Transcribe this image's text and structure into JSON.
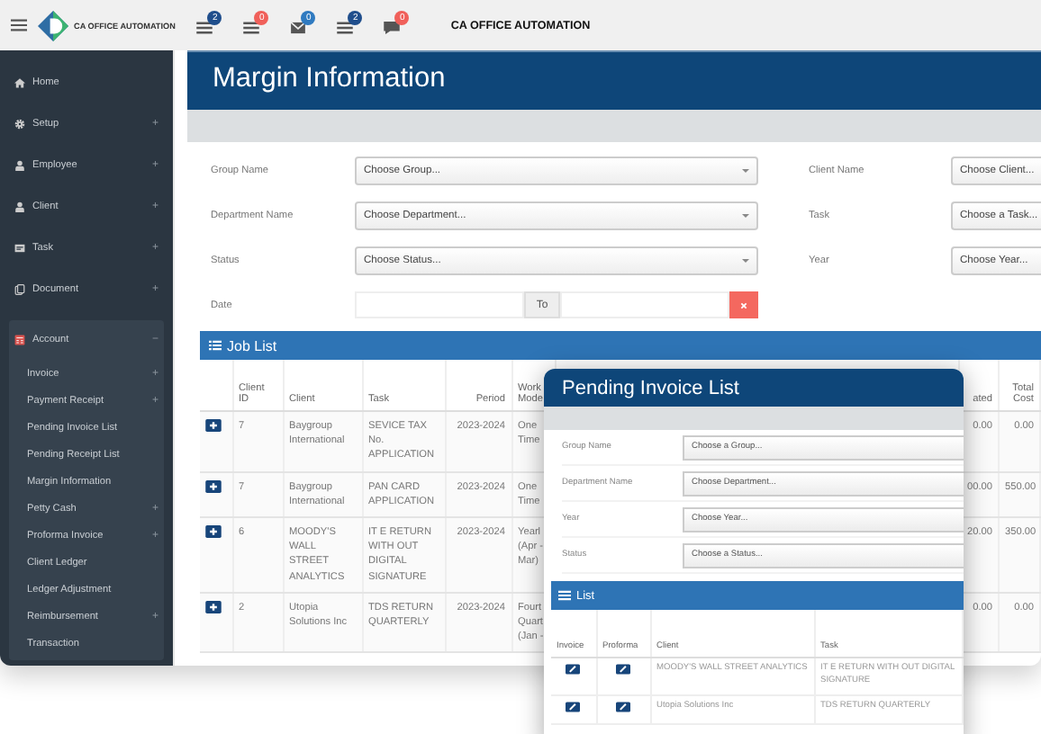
{
  "topbar": {
    "app_name": "CA OFFICE AUTOMATION",
    "title": "CA OFFICE AUTOMATION",
    "notifications": [
      {
        "kind": "list",
        "count": "2",
        "color": "#1f4e8c"
      },
      {
        "kind": "list",
        "count": "0",
        "color": "#f0605a"
      },
      {
        "kind": "envelope",
        "count": "0",
        "color": "#2f7ac0"
      },
      {
        "kind": "list",
        "count": "2",
        "color": "#1f4e8c"
      },
      {
        "kind": "comment",
        "count": "0",
        "color": "#f0605a"
      }
    ]
  },
  "sidebar": {
    "items": [
      {
        "kind": "home",
        "label": "Home",
        "expanded": false
      },
      {
        "kind": "gear",
        "label": "Setup",
        "toggle": "+",
        "expanded": false
      },
      {
        "kind": "user",
        "label": "Employee",
        "toggle": "+",
        "expanded": false
      },
      {
        "kind": "user",
        "label": "Client",
        "toggle": "+",
        "expanded": false
      },
      {
        "kind": "card",
        "label": "Task",
        "toggle": "+",
        "expanded": false
      },
      {
        "kind": "document",
        "label": "Document",
        "toggle": "+",
        "expanded": false
      },
      {
        "kind": "calculator",
        "label": "Account",
        "toggle": "−",
        "expanded": true,
        "children": [
          {
            "label": "Invoice",
            "toggle": "+"
          },
          {
            "label": "Payment Receipt",
            "toggle": "+"
          },
          {
            "label": "Pending Invoice List"
          },
          {
            "label": "Pending Receipt List"
          },
          {
            "label": "Margin Information"
          },
          {
            "label": "Petty Cash",
            "toggle": "+"
          },
          {
            "label": "Proforma Invoice",
            "toggle": "+"
          },
          {
            "label": "Client Ledger"
          },
          {
            "label": "Ledger Adjustment"
          },
          {
            "label": "Reimbursement",
            "toggle": "+"
          },
          {
            "label": "Transaction"
          }
        ]
      }
    ]
  },
  "main": {
    "title": "Margin Information",
    "filters": [
      {
        "kind": "select",
        "label": "Group Name",
        "placeholder": "Choose Group..."
      },
      {
        "kind": "select",
        "label": "Client Name",
        "placeholder": "Choose Client..."
      },
      {
        "kind": "select",
        "label": "Department Name",
        "placeholder": "Choose Department..."
      },
      {
        "kind": "select",
        "label": "Task",
        "placeholder": "Choose a Task..."
      },
      {
        "kind": "select",
        "label": "Status",
        "placeholder": "Choose Status..."
      },
      {
        "kind": "select",
        "label": "Year",
        "placeholder": "Choose Year..."
      },
      {
        "kind": "date_range",
        "label": "Date",
        "separator": "To"
      }
    ],
    "job_list": {
      "title": "Job List",
      "columns": [
        "Client ID",
        "Client",
        "Task",
        "Period",
        "Work Mode",
        "ated",
        "Total Cost"
      ],
      "rows": [
        [
          "7",
          "Baygroup International",
          "SEVICE TAX No. APPLICATION",
          "2023-2024",
          "One Time",
          "0.00",
          "0.00"
        ],
        [
          "7",
          "Baygroup International",
          "PAN CARD APPLICATION",
          "2023-2024",
          "One Time",
          "00.00",
          "550.00"
        ],
        [
          "6",
          "MOODY'S WALL STREET ANALYTICS",
          "IT E RETURN WITH OUT DIGITAL SIGNATURE",
          "2023-2024",
          "Yearl (Apr - Mar)",
          "20.00",
          "350.00"
        ],
        [
          "2",
          "Utopia Solutions Inc",
          "TDS RETURN QUARTERLY",
          "2023-2024",
          "Fourt Quart (Jan -",
          "0.00",
          "0.00"
        ]
      ]
    }
  },
  "pending_invoice_panel": {
    "title": "Pending Invoice List",
    "filters": [
      {
        "label": "Group Name",
        "placeholder": "Choose a Group..."
      },
      {
        "label": "Department Name",
        "placeholder": "Choose Department..."
      },
      {
        "label": "Year",
        "placeholder": "Choose Year..."
      },
      {
        "label": "Status",
        "placeholder": "Choose a Status..."
      }
    ],
    "list": {
      "title": "List",
      "columns": [
        "Invoice",
        "Proforma",
        "Client",
        "Task"
      ],
      "rows": [
        {
          "client": "MOODY'S WALL STREET ANALYTICS",
          "task": "IT E RETURN WITH OUT DIGITAL SIGNATURE"
        },
        {
          "client": "Utopia Solutions Inc",
          "task": "TDS RETURN QUARTERLY"
        }
      ]
    }
  }
}
